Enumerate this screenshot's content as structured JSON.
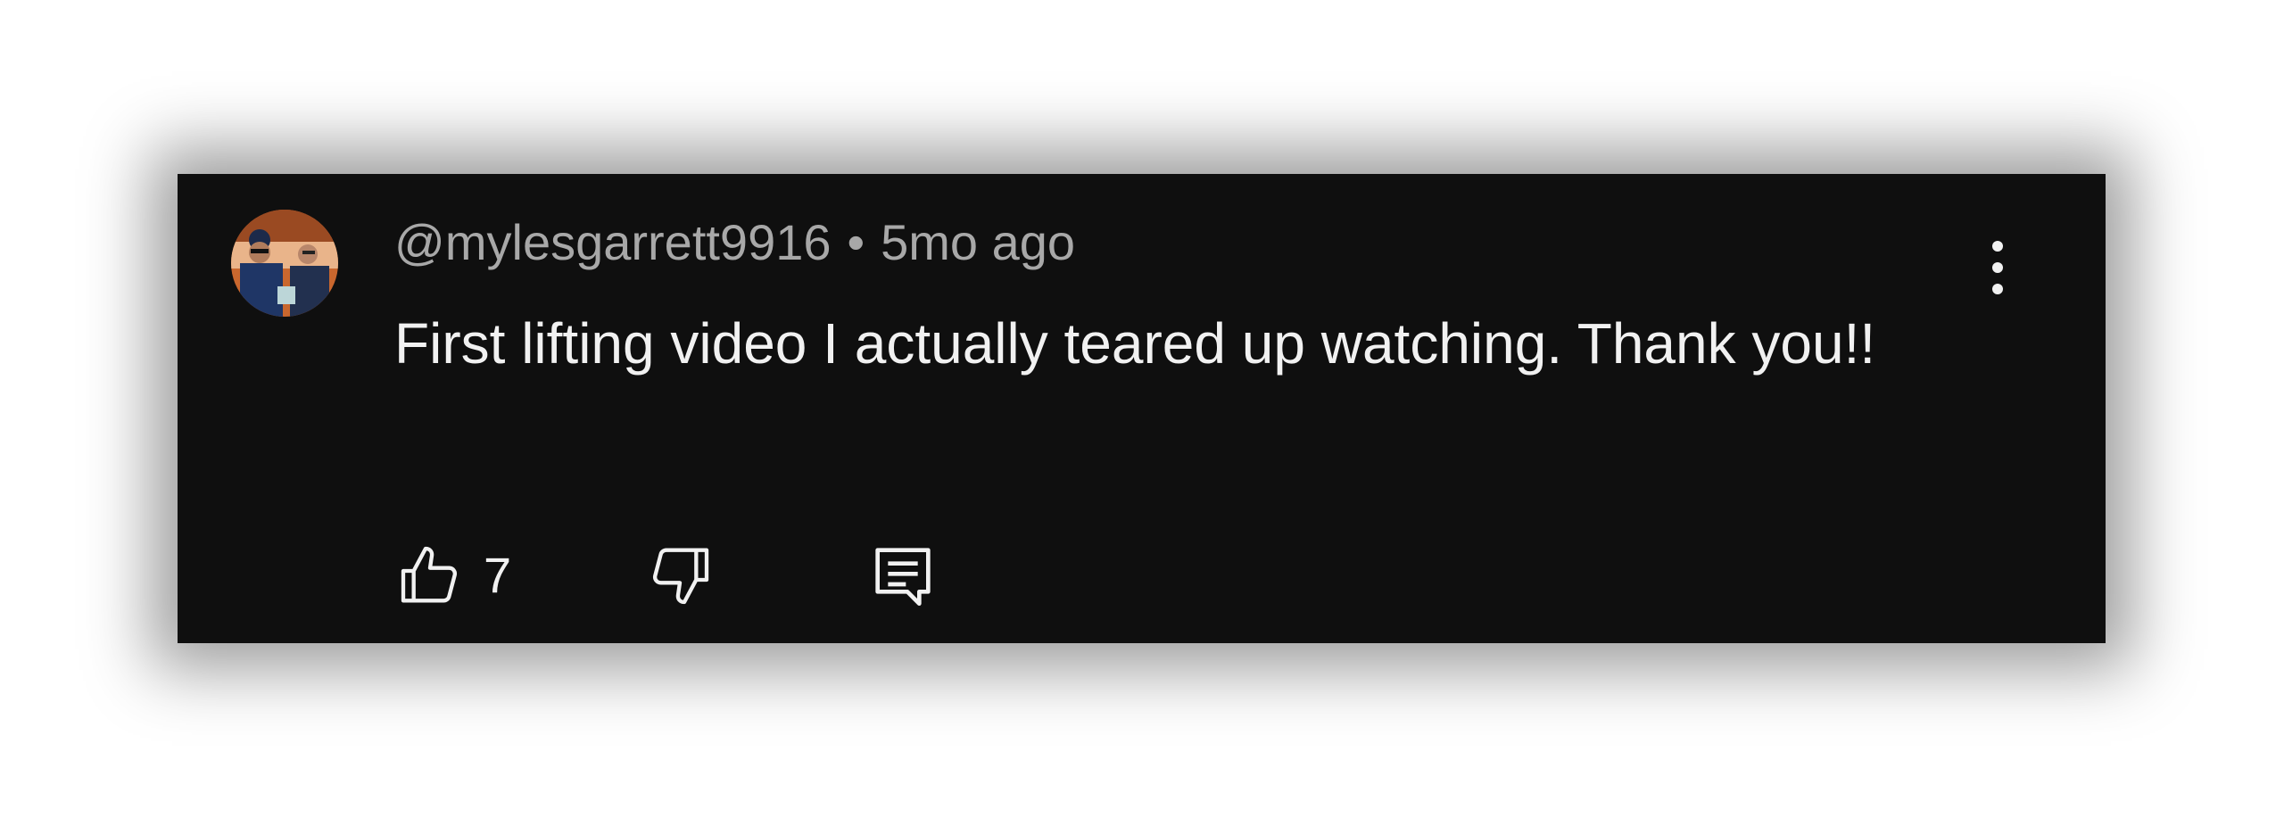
{
  "comment": {
    "author": "@mylesgarrett9916",
    "separator": "•",
    "time": "5mo ago",
    "text": "First lifting video I actually teared up watching. Thank you!!",
    "like_count": "7"
  },
  "icons": {
    "avatar": "avatar-photo",
    "more": "more-vertical-icon",
    "like": "thumbs-up-icon",
    "dislike": "thumbs-down-icon",
    "reply": "reply-comment-icon"
  },
  "colors": {
    "background": "#0f0f0f",
    "text": "#f1f1f1",
    "meta_text": "#a8a8a8"
  }
}
